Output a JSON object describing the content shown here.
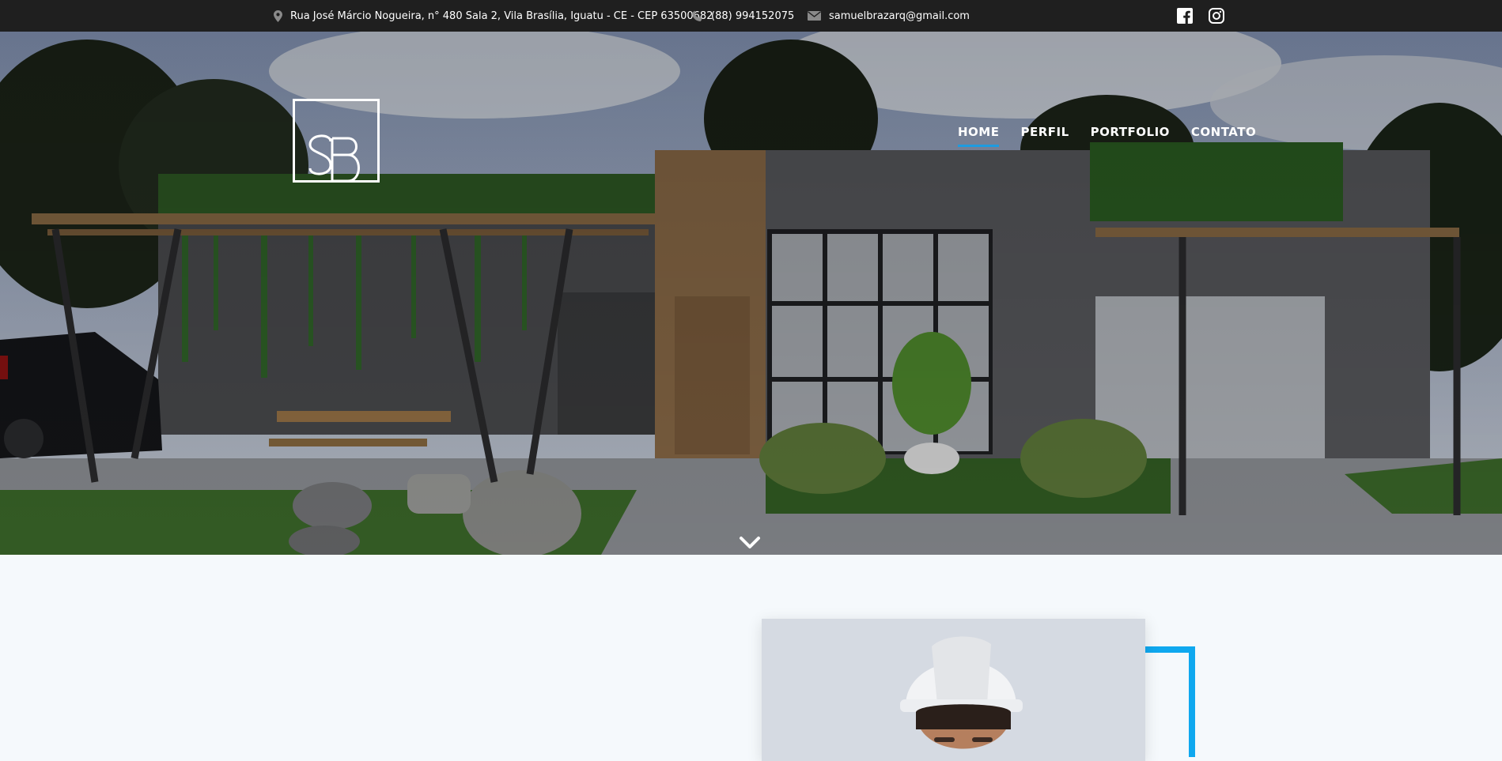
{
  "topbar": {
    "address": "Rua José Márcio Nogueira, n° 480 Sala 2, Vila Brasília, Iguatu - CE - CEP 63500682",
    "phone": "(88) 994152075",
    "email": "samuelbrazarq@gmail.com",
    "icons": [
      "map-pin-icon",
      "phone-icon",
      "envelope-icon",
      "facebook-icon",
      "instagram-icon"
    ]
  },
  "header": {
    "logo_icon": "sb-monogram-logo",
    "nav": [
      {
        "label": "HOME",
        "active": true
      },
      {
        "label": "PERFIL",
        "active": false
      },
      {
        "label": "PORTFOLIO",
        "active": false
      },
      {
        "label": "CONTATO",
        "active": false
      }
    ]
  },
  "hero": {
    "scroll_icon": "chevron-down-icon"
  },
  "colors": {
    "topbar": "#1f1f1f",
    "accent": "#0fa8ef",
    "nav_underline": "#1e9be0",
    "section_bg": "#f5f9fc"
  }
}
